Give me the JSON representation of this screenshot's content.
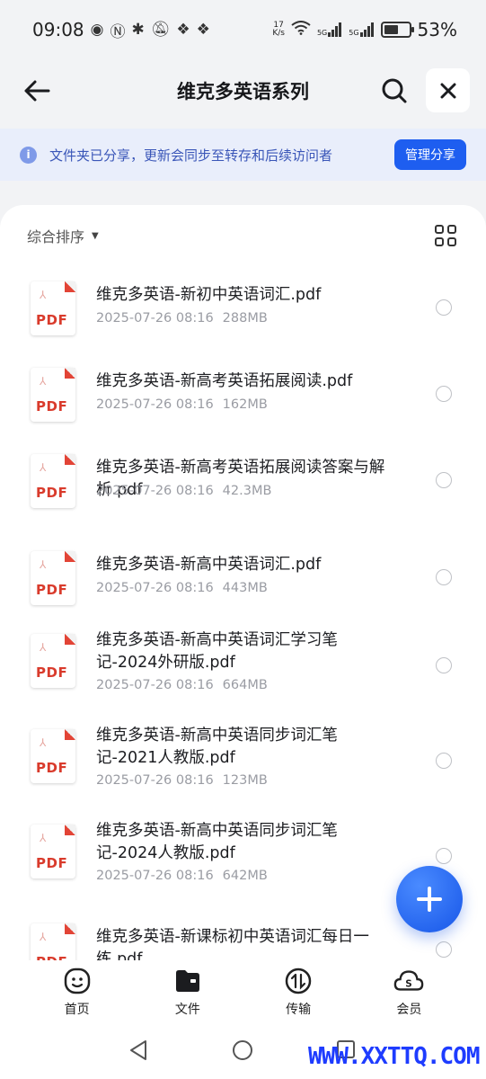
{
  "status_bar": {
    "time": "09:08",
    "net_speed_top": "17",
    "net_speed_bottom": "K/s",
    "signal1": "5G",
    "signal2": "5G",
    "battery": "53%"
  },
  "nav": {
    "title": "维克多英语系列"
  },
  "banner": {
    "text": "文件夹已分享，更新会同步至转存和后续访问者",
    "button": "管理分享",
    "info_glyph": "i"
  },
  "sort": {
    "label": "综合排序"
  },
  "files": [
    {
      "name": "维克多英语-新初中英语词汇.pdf",
      "date": "2025-07-26 08:16",
      "size": "288MB"
    },
    {
      "name": "维克多英语-新高考英语拓展阅读.pdf",
      "date": "2025-07-26 08:16",
      "size": "162MB"
    },
    {
      "name": "维克多英语-新高考英语拓展阅读答案与解析.pdf",
      "date": "2025-07-26 08:16",
      "size": "42.3MB"
    },
    {
      "name": "维克多英语-新高中英语词汇.pdf",
      "date": "2025-07-26 08:16",
      "size": "443MB"
    },
    {
      "name": "维克多英语-新高中英语词汇学习笔记-2024外研版.pdf",
      "date": "2025-07-26 08:16",
      "size": "664MB"
    },
    {
      "name": "维克多英语-新高中英语同步词汇笔记-2021人教版.pdf",
      "date": "2025-07-26 08:16",
      "size": "123MB"
    },
    {
      "name": "维克多英语-新高中英语同步词汇笔记-2024人教版.pdf",
      "date": "2025-07-26 08:16",
      "size": "642MB"
    },
    {
      "name": "维克多英语-新课标初中英语词汇每日一练.pdf",
      "date": "",
      "size": ""
    }
  ],
  "pdf_label": "PDF",
  "tabs": [
    {
      "label": "首页",
      "icon": "home-face-icon"
    },
    {
      "label": "文件",
      "icon": "folder-icon"
    },
    {
      "label": "传输",
      "icon": "transfer-icon"
    },
    {
      "label": "会员",
      "icon": "vip-cloud-icon"
    }
  ],
  "watermark": "WWW.XXTTQ.COM",
  "colors": {
    "accent": "#1e5ef0",
    "pdf_red": "#d93b2c",
    "banner_bg": "#e9eefb"
  }
}
